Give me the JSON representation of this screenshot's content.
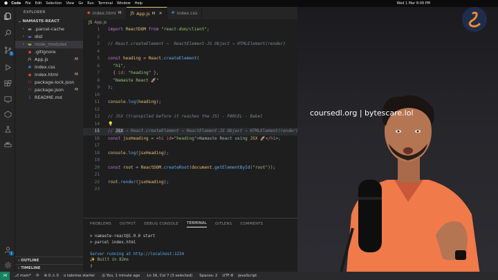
{
  "mac_menu": {
    "app": "Code",
    "items": [
      "File",
      "Edit",
      "Selection",
      "View",
      "Go",
      "Run",
      "Terminal",
      "Window",
      "Help"
    ],
    "clock": "Wed 1 Mar 8:09 PM"
  },
  "activity_bar": {
    "scm_badge": "5",
    "account_badge": "1"
  },
  "sidebar": {
    "title": "EXPLORER",
    "root": "NAMASTE-REACT",
    "items": [
      {
        "name": ".parcel-cache",
        "type": "folder",
        "flag": ""
      },
      {
        "name": "dist",
        "type": "folder",
        "flag": ""
      },
      {
        "name": "node_modules",
        "type": "folder",
        "flag": ""
      },
      {
        "name": ".gitignore",
        "type": "file",
        "flag": ""
      },
      {
        "name": "App.js",
        "type": "file",
        "flag": "M"
      },
      {
        "name": "index.css",
        "type": "file",
        "flag": ""
      },
      {
        "name": "index.html",
        "type": "file",
        "flag": "M"
      },
      {
        "name": "package-lock.json",
        "type": "file",
        "flag": ""
      },
      {
        "name": "package.json",
        "type": "file",
        "flag": "M"
      },
      {
        "name": "README.md",
        "type": "file",
        "flag": ""
      }
    ],
    "outline": "OUTLINE",
    "timeline": "TIMELINE"
  },
  "tabs": [
    {
      "name": "index.html",
      "flag": "M"
    },
    {
      "name": "App.js",
      "flag": "M"
    },
    {
      "name": "index.css",
      "flag": ""
    }
  ],
  "breadcrumb": "App.js",
  "code_lines": [
    {
      "n": "1",
      "segs": [
        [
          "t-kw",
          "import "
        ],
        [
          "t-var",
          "ReactDOM"
        ],
        [
          "t-kw",
          " from "
        ],
        [
          "t-str",
          "\"react-dom/client\""
        ],
        [
          "t-pun",
          ";"
        ]
      ]
    },
    {
      "n": "2",
      "segs": []
    },
    {
      "n": "3",
      "segs": [
        [
          "t-com",
          "// React.createElement ⇒  ReactElement-JS Object ⇒ HTMLElement(render)"
        ]
      ]
    },
    {
      "n": "4",
      "segs": []
    },
    {
      "n": "5",
      "segs": [
        [
          "t-kw",
          "const "
        ],
        [
          "t-var",
          "heading"
        ],
        [
          "t-pun",
          " = "
        ],
        [
          "t-var",
          "React"
        ],
        [
          "t-pun",
          "."
        ],
        [
          "t-fn",
          "createElement"
        ],
        [
          "t-pun",
          "("
        ]
      ]
    },
    {
      "n": "6",
      "segs": [
        [
          "t-str",
          "  \"h1\""
        ],
        [
          "t-pun",
          ","
        ]
      ]
    },
    {
      "n": "7",
      "segs": [
        [
          "t-pun",
          "  { "
        ],
        [
          "t-prop",
          "id"
        ],
        [
          "t-pun",
          ": "
        ],
        [
          "t-str",
          "\"heading\""
        ],
        [
          "t-pun",
          " },"
        ]
      ]
    },
    {
      "n": "8",
      "segs": [
        [
          "t-str",
          "  \"Namaste React 🚀\""
        ]
      ]
    },
    {
      "n": "9",
      "segs": [
        [
          "t-pun",
          ");"
        ]
      ]
    },
    {
      "n": "10",
      "segs": []
    },
    {
      "n": "11",
      "segs": [
        [
          "t-var",
          "console"
        ],
        [
          "t-pun",
          "."
        ],
        [
          "t-fn",
          "log"
        ],
        [
          "t-pun",
          "("
        ],
        [
          "t-var",
          "heading"
        ],
        [
          "t-pun",
          ");"
        ]
      ]
    },
    {
      "n": "12",
      "segs": []
    },
    {
      "n": "13",
      "segs": [
        [
          "t-com",
          "// JSX (transpiled before it reaches the JS) - PARCEL - Babel"
        ]
      ]
    },
    {
      "n": "14",
      "segs": [
        [
          "t-pun",
          "💡"
        ]
      ]
    },
    {
      "n": "15",
      "segs": [
        [
          "t-com",
          "// "
        ],
        [
          "t-hl",
          "JSX"
        ],
        [
          "t-com",
          " ⇒ React.createElement ⇒ ReactElement-JS Object ⇒ HTMLElement(render)"
        ]
      ],
      "blame": "You, 1 minute ago",
      "current": true
    },
    {
      "n": "16",
      "segs": [
        [
          "t-kw",
          "const "
        ],
        [
          "t-var",
          "jsxHeading"
        ],
        [
          "t-pun",
          " = <"
        ],
        [
          "t-tag",
          "h1"
        ],
        [
          "t-prop",
          " id"
        ],
        [
          "t-pun",
          "="
        ],
        [
          "t-str",
          "\"heading\""
        ],
        [
          "t-pun",
          ">Namaste React using "
        ],
        [
          "t-var",
          "JSX"
        ],
        [
          "t-pun",
          " 🚀</"
        ],
        [
          "t-tag",
          "h1"
        ],
        [
          "t-pun",
          ">;"
        ]
      ]
    },
    {
      "n": "17",
      "segs": []
    },
    {
      "n": "18",
      "segs": [
        [
          "t-var",
          "console"
        ],
        [
          "t-pun",
          "."
        ],
        [
          "t-fn",
          "log"
        ],
        [
          "t-pun",
          "("
        ],
        [
          "t-var",
          "jsxHeading"
        ],
        [
          "t-pun",
          ");"
        ]
      ]
    },
    {
      "n": "19",
      "segs": []
    },
    {
      "n": "20",
      "segs": [
        [
          "t-kw",
          "const "
        ],
        [
          "t-var",
          "root"
        ],
        [
          "t-pun",
          " = "
        ],
        [
          "t-var",
          "ReactDOM"
        ],
        [
          "t-pun",
          "."
        ],
        [
          "t-fn",
          "createRoot"
        ],
        [
          "t-pun",
          "("
        ],
        [
          "t-var",
          "document"
        ],
        [
          "t-pun",
          "."
        ],
        [
          "t-fn",
          "getElementById"
        ],
        [
          "t-pun",
          "("
        ],
        [
          "t-str",
          "\"root\""
        ],
        [
          "t-pun",
          "));"
        ]
      ]
    },
    {
      "n": "21",
      "segs": []
    },
    {
      "n": "22",
      "segs": [
        [
          "t-var",
          "root"
        ],
        [
          "t-pun",
          "."
        ],
        [
          "t-fn",
          "render"
        ],
        [
          "t-pun",
          "("
        ],
        [
          "t-var",
          "jsxHeading"
        ],
        [
          "t-pun",
          ");"
        ]
      ]
    },
    {
      "n": "23",
      "segs": []
    }
  ],
  "panel": {
    "tabs": [
      "PROBLEMS",
      "OUTPUT",
      "DEBUG CONSOLE",
      "TERMINAL",
      "GITLENS",
      "COMMENTS"
    ],
    "active_tab": "TERMINAL",
    "terminal": [
      {
        "text": "> namaste-react@1.0.0 start",
        "style": ""
      },
      {
        "text": "> parcel index.html",
        "style": ""
      },
      {
        "text": "",
        "style": ""
      },
      {
        "text": "Server running at http://localhost:1234",
        "style": "blue"
      },
      {
        "text": "✨ Built in 82ms",
        "style": "green"
      }
    ]
  },
  "status": {
    "branch": "main*",
    "sync": "⟳",
    "errors": "⊗ 0 ⚠ 0",
    "tabnine": "o tabnine starter",
    "blame": "You, 1 minute ago",
    "position": "Ln 16, Col 7 (3 selected)",
    "spaces": "Spaces: 2",
    "encoding": "UTF-8",
    "language": "JavaScript"
  },
  "video": {
    "watermark": "coursedl.org | bytescare.lol"
  },
  "colors": {
    "editor_bg": "#1e1e1e",
    "sidebar_bg": "#252526",
    "accent": "#e5c07b",
    "modified": "#e2c08d",
    "remote": "#16825d"
  }
}
